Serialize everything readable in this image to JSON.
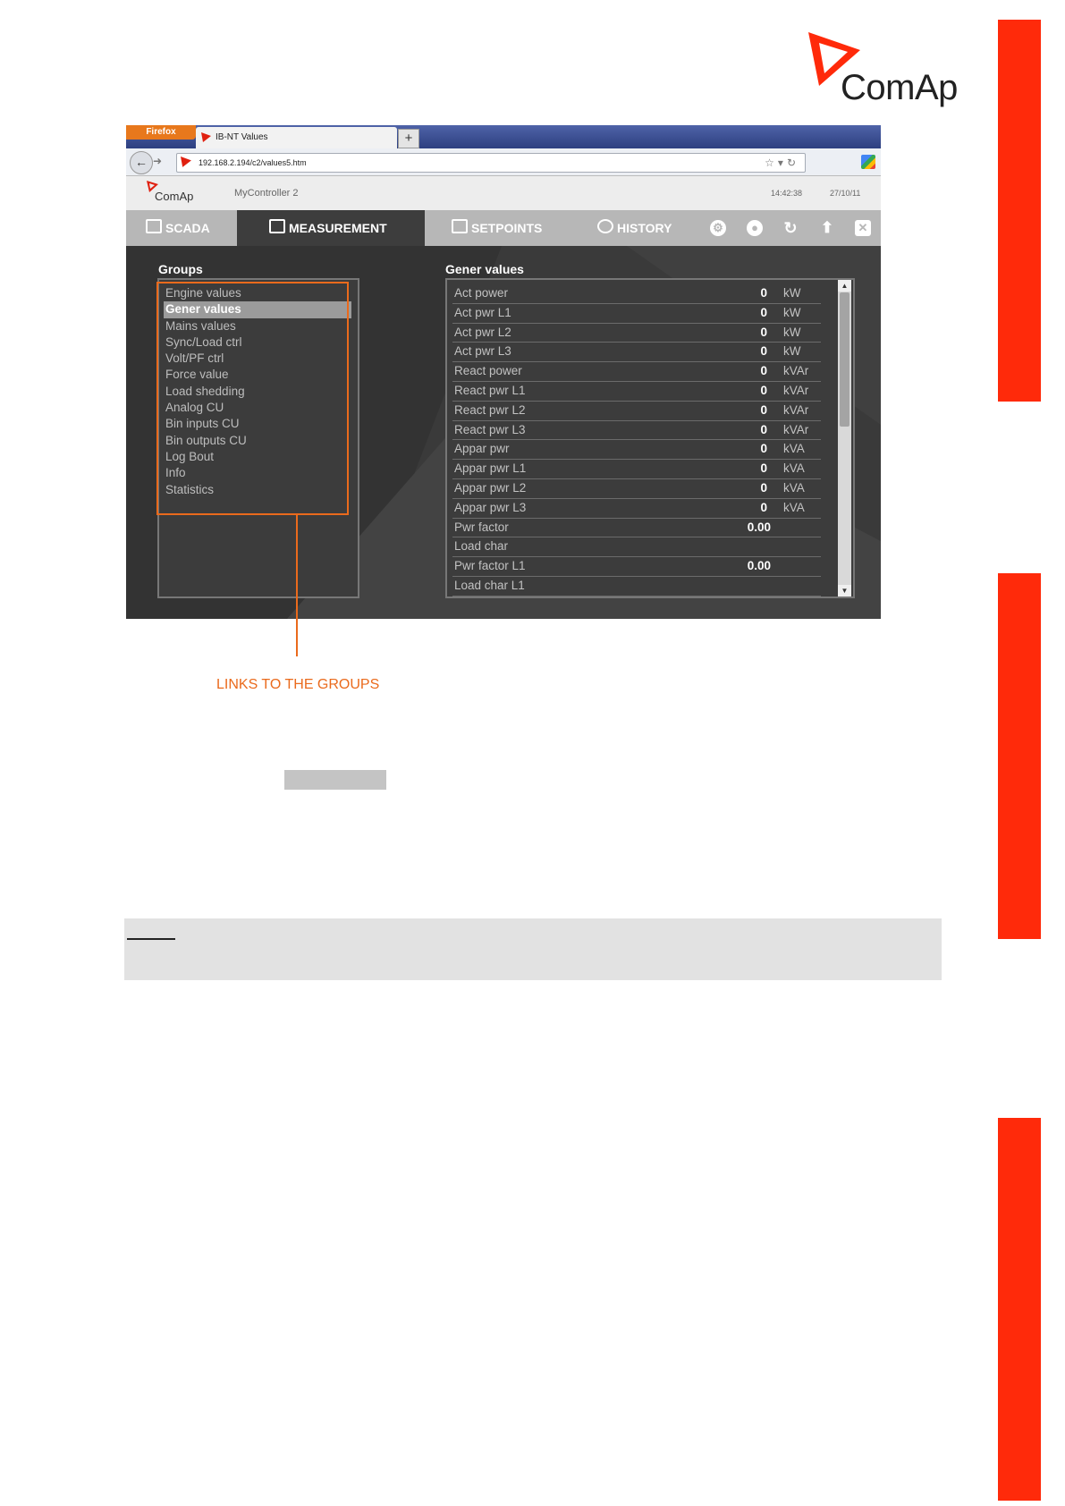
{
  "brand": {
    "logo_text": "ComAp",
    "accent_red": "#ff2a0a",
    "callout_orange": "#ea6a1c"
  },
  "browser": {
    "app_button": "Firefox",
    "tab_title": "IB-NT Values",
    "new_tab": "+",
    "url": "192.168.2.194/c2/values5.htm"
  },
  "app": {
    "logo_text": "ComAp",
    "controller_name": "MyController 2",
    "time": "14:42:38",
    "date": "27/10/11"
  },
  "menu": {
    "scada": "SCADA",
    "measurement": "MEASUREMENT",
    "setpoints": "SETPOINTS",
    "history": "HISTORY"
  },
  "groups": {
    "title": "Groups",
    "items": [
      "Engine values",
      "Gener values",
      "Mains values",
      "Sync/Load ctrl",
      "Volt/PF ctrl",
      "Force value",
      "Load shedding",
      "Analog CU",
      "Bin inputs CU",
      "Bin outputs CU",
      "Log Bout",
      "Info",
      "Statistics"
    ],
    "selected": "Gener values"
  },
  "values": {
    "title": "Gener values",
    "rows": [
      {
        "name": "Act power",
        "value": "0",
        "unit": "kW"
      },
      {
        "name": "Act pwr L1",
        "value": "0",
        "unit": "kW"
      },
      {
        "name": "Act pwr L2",
        "value": "0",
        "unit": "kW"
      },
      {
        "name": "Act pwr L3",
        "value": "0",
        "unit": "kW"
      },
      {
        "name": "React power",
        "value": "0",
        "unit": "kVAr"
      },
      {
        "name": "React pwr L1",
        "value": "0",
        "unit": "kVAr"
      },
      {
        "name": "React pwr L2",
        "value": "0",
        "unit": "kVAr"
      },
      {
        "name": "React pwr L3",
        "value": "0",
        "unit": "kVAr"
      },
      {
        "name": "Appar pwr",
        "value": "0",
        "unit": "kVA"
      },
      {
        "name": "Appar pwr L1",
        "value": "0",
        "unit": "kVA"
      },
      {
        "name": "Appar pwr L2",
        "value": "0",
        "unit": "kVA"
      },
      {
        "name": "Appar pwr L3",
        "value": "0",
        "unit": "kVA"
      },
      {
        "name": "Pwr factor",
        "value": "0.00",
        "unit": ""
      },
      {
        "name": "Load char",
        "value": "",
        "unit": ""
      },
      {
        "name": "Pwr factor L1",
        "value": "0.00",
        "unit": ""
      },
      {
        "name": "Load char L1",
        "value": "",
        "unit": ""
      }
    ]
  },
  "callout": {
    "text": "LINKS TO THE GROUPS"
  }
}
